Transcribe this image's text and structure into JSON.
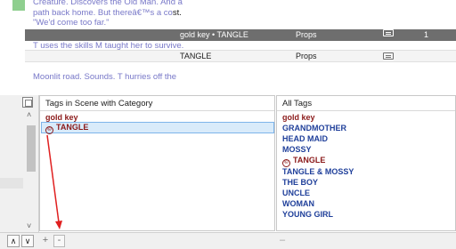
{
  "script": {
    "partial_line": "Creature. Discovers the Old Man. And a",
    "line2": "path back home. But thereâ€™s a co",
    "line2_tail": "st.",
    "line3": "\"We'd come too far.\"",
    "selected_row": {
      "tags": "gold key • TANGLE",
      "category": "Props",
      "count": "1"
    },
    "line4": "T uses the skills M taught her to survive.",
    "plain_row": {
      "tags": "TANGLE",
      "category": "Props"
    },
    "cut_line": "Moonlit road.  Sounds.  T hurries off the"
  },
  "scene_tags": {
    "header": "Tags in Scene with Category",
    "items": [
      {
        "label": "gold key",
        "kind": "category"
      },
      {
        "label": "TANGLE",
        "kind": "selected-tag",
        "symbol": "©"
      }
    ]
  },
  "all_tags": {
    "header": "All Tags",
    "items": [
      {
        "label": "gold key",
        "color": "#8b1a1a"
      },
      {
        "label": "GRANDMOTHER",
        "color": "#1f3f9a"
      },
      {
        "label": "HEAD MAID",
        "color": "#1f3f9a"
      },
      {
        "label": "MOSSY",
        "color": "#1f3f9a"
      },
      {
        "label": "TANGLE",
        "color": "#8b1a1a",
        "symbol": "©"
      },
      {
        "label": "TANGLE & MOSSY",
        "color": "#1f3f9a"
      },
      {
        "label": "THE BOY",
        "color": "#1f3f9a"
      },
      {
        "label": "UNCLE",
        "color": "#1f3f9a"
      },
      {
        "label": "WOMAN",
        "color": "#1f3f9a"
      },
      {
        "label": "YOUNG GIRL",
        "color": "#1f3f9a"
      }
    ]
  },
  "bottom": {
    "up": "∧",
    "down": "∨",
    "add": "+",
    "remove": "-",
    "right_remove": "–"
  },
  "icons": {
    "grid": "grid-icon",
    "note": "note-icon",
    "copyright": "copyright-icon",
    "scroll_up": "˄",
    "scroll_down": "˅"
  },
  "colors": {
    "selected_row_bg": "#6e6e6e",
    "category_red": "#8b1a1a",
    "tag_blue": "#1f3f9a",
    "selection_highlight": "#d9ebfa",
    "annotation_arrow": "#e02020",
    "script_text": "#7878c8"
  }
}
